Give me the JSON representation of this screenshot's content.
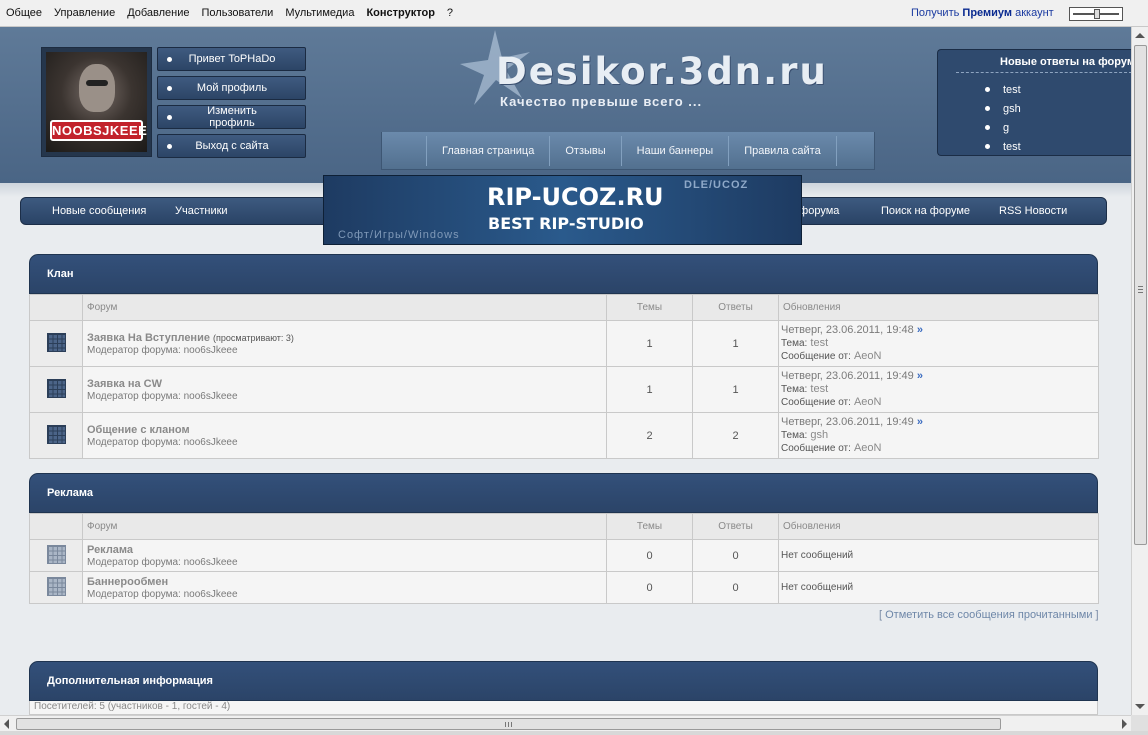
{
  "admin_bar": {
    "menu": [
      "Общее",
      "Управление",
      "Добавление",
      "Пользователи",
      "Мультимедиа",
      "Конструктор",
      "?"
    ],
    "premium_prefix": "Получить",
    "premium_bold": "Премиум",
    "premium_suffix": "аккаунт"
  },
  "user_panel": {
    "avatar_nick": "NOOBSJKEEE",
    "buttons": [
      "Привет ToPHaDo",
      "Мой профиль",
      "Изменить профиль",
      "Выход с сайта"
    ]
  },
  "logo": {
    "title": "Desikor.3dn.ru",
    "slogan": "Качество превыше всего ..."
  },
  "top_nav": [
    "Главная страница",
    "Отзывы",
    "Наши баннеры",
    "Правила сайта"
  ],
  "new_answers": {
    "title": "Новые ответы на форуме",
    "items": [
      "test",
      "gsh",
      "g",
      "test"
    ]
  },
  "forum_nav": [
    "Новые сообщения",
    "Участники",
    "а форума",
    "Поиск на форуме",
    "RSS Новости"
  ],
  "banner": {
    "line1": "RIP-UCOZ.RU",
    "line2": "BEST RIP-STUDIO",
    "corner": "DLE/UCOZ",
    "bottom": "Софт/Игры/Windows"
  },
  "columns": {
    "forum": "Форум",
    "topics": "Темы",
    "replies": "Ответы",
    "updates": "Обновления"
  },
  "labels": {
    "moderator": "Модератор форума:",
    "topic": "Тема:",
    "message_from": "Сообщение от:",
    "no_messages": "Нет сообщений",
    "arrow": "»"
  },
  "sections": [
    {
      "title": "Клан",
      "forums": [
        {
          "name": "Заявка На Вступление",
          "viewing": "(просматривают: 3)",
          "moderator": "noo6sJkeee",
          "topics": "1",
          "replies": "1",
          "date": "Четверг, 23.06.2011, 19:48",
          "topic": "test",
          "from": "AeoN"
        },
        {
          "name": "Заявка на CW",
          "viewing": "",
          "moderator": "noo6sJkeee",
          "topics": "1",
          "replies": "1",
          "date": "Четверг, 23.06.2011, 19:49",
          "topic": "test",
          "from": "AeoN"
        },
        {
          "name": "Общение с кланом",
          "viewing": "",
          "moderator": "noo6sJkeee",
          "topics": "2",
          "replies": "2",
          "date": "Четверг, 23.06.2011, 19:49",
          "topic": "gsh",
          "from": "AeoN"
        }
      ]
    },
    {
      "title": "Реклама",
      "forums": [
        {
          "name": "Реклама",
          "moderator": "noo6sJkeee",
          "topics": "0",
          "replies": "0"
        },
        {
          "name": "Баннерообмен",
          "moderator": "noo6sJkeee",
          "topics": "0",
          "replies": "0"
        }
      ]
    },
    {
      "title": "Дополнительная информация"
    }
  ],
  "mark_all_read": "Отметить все сообщения прочитанными",
  "extra_info_line": "Посетителей: 5 (участников - 1, гостей - 4)"
}
